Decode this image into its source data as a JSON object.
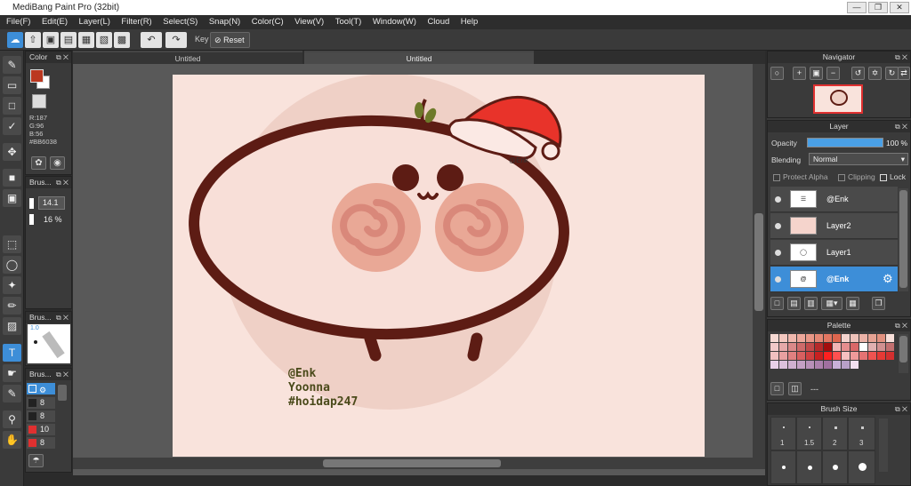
{
  "app": {
    "title": "MediBang Paint Pro (32bit)",
    "window_controls": [
      "minimize-icon",
      "restore-icon",
      "close-icon"
    ]
  },
  "menu": [
    "File(F)",
    "Edit(E)",
    "Layer(L)",
    "Filter(R)",
    "Select(S)",
    "Snap(N)",
    "Color(C)",
    "View(V)",
    "Tool(T)",
    "Window(W)",
    "Cloud",
    "Help"
  ],
  "toolbar": {
    "key_label": "Key",
    "reset_label": "Reset"
  },
  "color_panel": {
    "title": "Color",
    "r": "R:187",
    "g": "G:96",
    "b": "B:56",
    "hex": "#BB6038",
    "primary_color": "#BB3820",
    "secondary_color": "#FFFFFF"
  },
  "brush_panel": {
    "title": "Brus...",
    "size": "14.1",
    "opacity": "16 %"
  },
  "brush_preview_panel": {
    "title": "Brus...",
    "size_label": "1.0"
  },
  "brush_list_panel": {
    "title": "Brus...",
    "items": [
      {
        "value": "8"
      },
      {
        "value": "8"
      },
      {
        "value": "10"
      },
      {
        "value": "8"
      }
    ]
  },
  "tabs": [
    {
      "label": "Untitled"
    },
    {
      "label": "Untitled"
    }
  ],
  "artwork": {
    "signature": [
      "@Enk",
      "Yoonna",
      "#hoidap247"
    ],
    "hat_tag": "@Enk"
  },
  "navigator": {
    "title": "Navigator"
  },
  "layer_panel": {
    "title": "Layer",
    "opacity_label": "Opacity",
    "opacity_value": "100 %",
    "blending_label": "Blending",
    "blending_value": "Normal",
    "protect_alpha": "Protect Alpha",
    "clipping": "Clipping",
    "lock": "Lock",
    "layers": [
      {
        "name": "@Enk"
      },
      {
        "name": "Layer2"
      },
      {
        "name": "Layer1"
      },
      {
        "name": "@Enk"
      }
    ]
  },
  "palette_panel": {
    "title": "Palette",
    "current": "---"
  },
  "brush_size_panel": {
    "title": "Brush Size",
    "sizes": [
      "1",
      "1.5",
      "2",
      "3"
    ]
  }
}
